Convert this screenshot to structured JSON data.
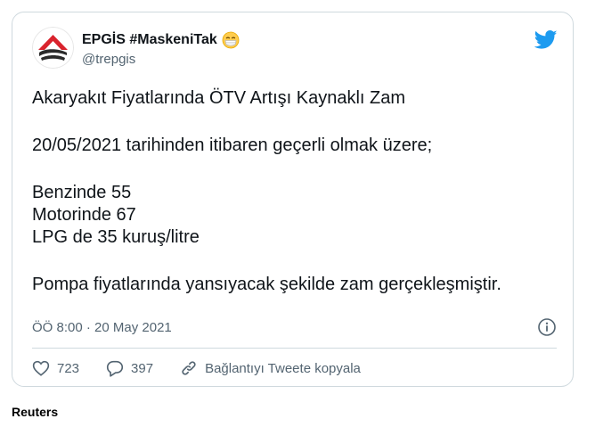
{
  "tweet": {
    "display_name": "EPGİS #MaskeniTak",
    "emoji": "face-with-medical-mask-icon",
    "handle": "@trepgis",
    "text_lines": [
      "Akaryakıt Fiyatlarında ÖTV Artışı Kaynaklı Zam",
      "20/05/2021 tarihinden itibaren geçerli olmak üzere;",
      "Benzinde 55",
      "Motorinde 67",
      "LPG de 35 kuruş/litre",
      "Pompa fiyatlarında yansıyacak şekilde zam gerçekleşmiştir."
    ],
    "timestamp": "ÖÖ 8:00 · 20 May 2021",
    "likes": "723",
    "replies": "397",
    "copy_link_label": "Bağlantıyı Tweete kopyala"
  },
  "source_caption": "Reuters",
  "colors": {
    "twitter_blue": "#1d9bf0",
    "muted_text": "#536471",
    "border": "#cfd9de",
    "brand_red": "#d9232d",
    "brand_dark": "#2b2b2b"
  },
  "icons": {
    "bird": "twitter-bird-icon",
    "info": "info-icon",
    "like": "heart-icon",
    "reply": "reply-bubble-icon",
    "link": "link-icon"
  }
}
